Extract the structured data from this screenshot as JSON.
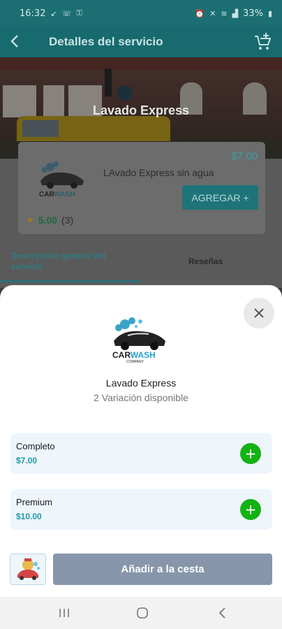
{
  "status_bar": {
    "time": "16:32",
    "battery": "33%",
    "icons_left": [
      "missed-call-icon",
      "phone-icon",
      "lock-icon"
    ],
    "icons_right": [
      "alarm-icon",
      "mute-icon",
      "wifi-icon",
      "signal-icon"
    ]
  },
  "app_bar": {
    "back_icon": "arrow-back-icon",
    "title": "Detalles del servicio",
    "cart_icon": "cart-plus-icon"
  },
  "hero": {
    "title": "Lavado Express"
  },
  "service_card": {
    "price": "$7.00",
    "name": "LAvado Express sin agua",
    "add_label": "AGREGAR +",
    "rating": "5.00",
    "rating_count": "(3)",
    "logo_text_1": "CAR",
    "logo_text_2": "WASH",
    "logo_sub": "COMPANY"
  },
  "tabs": [
    {
      "label": "Descripción general del servicio",
      "active": true
    },
    {
      "label": "Reseñas",
      "active": false
    }
  ],
  "sheet": {
    "close_icon": "close-icon",
    "name": "Lavado Express",
    "variations": "2 Variación disponible",
    "logo_text_1": "CAR",
    "logo_text_2": "WASH",
    "logo_sub": "COMPANY",
    "variants": [
      {
        "name": "Completo",
        "price": "$7.00"
      },
      {
        "name": "Premium",
        "price": "$10.00"
      }
    ],
    "add_to_basket": "Añadir a la cesta"
  },
  "nav_bar": {
    "icons": [
      "recent-apps-icon",
      "home-icon",
      "back-icon"
    ]
  },
  "colors": {
    "accent": "#1f9aa3",
    "add_button": "#13b213",
    "basket_button": "#8796ab"
  }
}
